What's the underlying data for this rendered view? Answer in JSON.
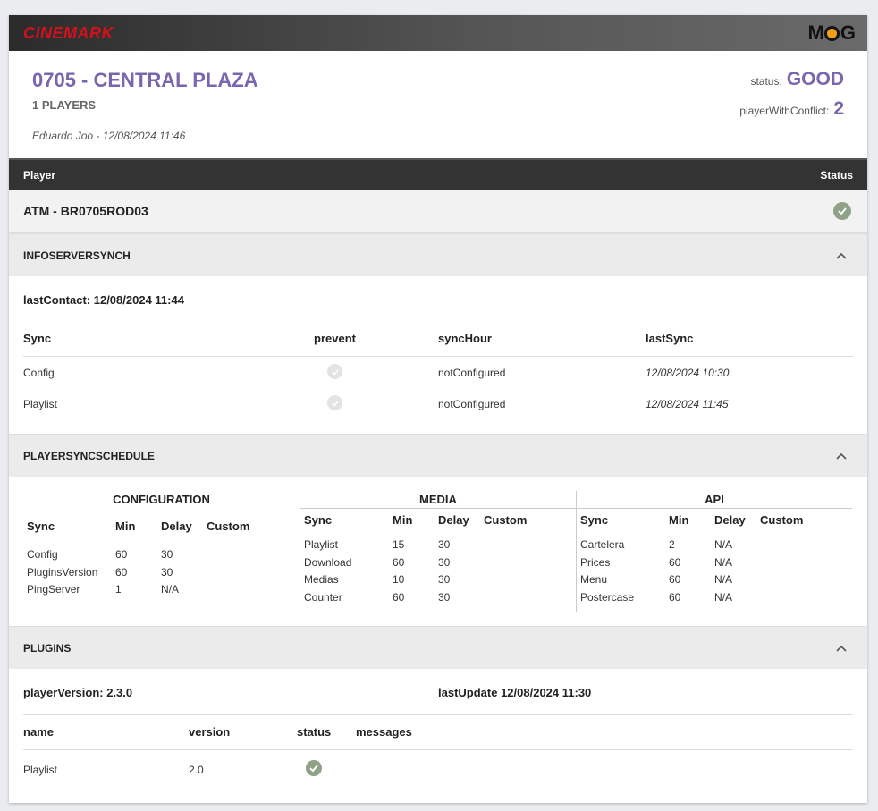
{
  "brand": "CINEMARK",
  "logo": "MOG",
  "header": {
    "site": "0705 - CENTRAL PLAZA",
    "players": "1 PLAYERS",
    "author": "Eduardo Joo - 12/08/2024 11:46",
    "status_label": "status:",
    "status_value": "GOOD",
    "conflict_label": "playerWithConflict:",
    "conflict_value": "2"
  },
  "table_head": {
    "player": "Player",
    "status": "Status"
  },
  "player": {
    "name": "ATM - BR0705ROD03",
    "status_icon": "check-circle-icon",
    "status_color": "#8fa286"
  },
  "infoserver": {
    "title": "INFOSERVERSYNCH",
    "last_contact": "lastContact: 12/08/2024 11:44",
    "columns": [
      "Sync",
      "prevent",
      "syncHour",
      "lastSync"
    ],
    "rows": [
      {
        "sync": "Config",
        "sync_hour": "notConfigured",
        "last_sync": "12/08/2024 10:30"
      },
      {
        "sync": "Playlist",
        "sync_hour": "notConfigured",
        "last_sync": "12/08/2024 11:45"
      }
    ]
  },
  "schedule": {
    "title": "PLAYERSYNCSCHEDULE",
    "columns": [
      "Sync",
      "Min",
      "Delay",
      "Custom"
    ],
    "groups": [
      {
        "title": "CONFIGURATION",
        "rows": [
          [
            "Config",
            "60",
            "30"
          ],
          [
            "PluginsVersion",
            "60",
            "30"
          ],
          [
            "PingServer",
            "1",
            "N/A"
          ]
        ]
      },
      {
        "title": "MEDIA",
        "rows": [
          [
            "Playlist",
            "15",
            "30"
          ],
          [
            "Download",
            "60",
            "30"
          ],
          [
            "Medias",
            "10",
            "30"
          ],
          [
            "Counter",
            "60",
            "30"
          ]
        ]
      },
      {
        "title": "API",
        "rows": [
          [
            "Cartelera",
            "2",
            "N/A"
          ],
          [
            "Prices",
            "60",
            "N/A"
          ],
          [
            "Menu",
            "60",
            "N/A"
          ],
          [
            "Postercase",
            "60",
            "N/A"
          ]
        ]
      }
    ]
  },
  "plugins": {
    "title": "PLUGINS",
    "player_version": "playerVersion: 2.3.0",
    "last_update": "lastUpdate 12/08/2024 11:30",
    "columns": [
      "name",
      "version",
      "status",
      "messages"
    ],
    "rows": [
      {
        "name": "Playlist",
        "version": "2.0",
        "message": ""
      }
    ]
  },
  "accent_color": "#7a66ad",
  "brand_color": "#d4101b"
}
